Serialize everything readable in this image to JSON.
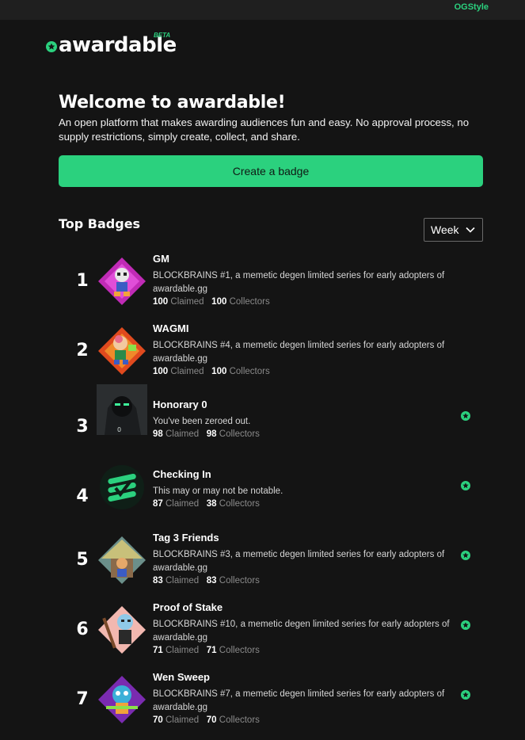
{
  "topbar": {
    "username": "OGStyle"
  },
  "brand": {
    "name": "awardable",
    "beta": "BETA",
    "accent": "#2bd17e"
  },
  "welcome": {
    "title": "Welcome to awardable!",
    "description": "An open platform that makes awarding audiences fun and easy. No approval process, no supply restrictions, simply create, collect, and share.",
    "cta": "Create a badge"
  },
  "top_badges": {
    "title": "Top Badges",
    "period": "Week",
    "claimed_label": "Claimed",
    "collectors_label": "Collectors",
    "items": [
      {
        "rank": "1",
        "name": "GM",
        "description": "BLOCKBRAINS #1, a memetic degen limited series for early adopters of awardable.gg",
        "claimed": "100",
        "collectors": "100",
        "verified": false,
        "art": "skull-pink"
      },
      {
        "rank": "2",
        "name": "WAGMI",
        "description": "BLOCKBRAINS #4, a memetic degen limited series for early adopters of awardable.gg",
        "claimed": "100",
        "collectors": "100",
        "verified": false,
        "art": "brain-orange"
      },
      {
        "rank": "3",
        "name": "Honorary 0",
        "description": "You've been zeroed out.",
        "claimed": "98",
        "collectors": "98",
        "verified": true,
        "art": "hooded-figure"
      },
      {
        "rank": "4",
        "name": "Checking In",
        "description": "This may or may not be notable.",
        "claimed": "87",
        "collectors": "38",
        "verified": true,
        "art": "check-logo"
      },
      {
        "rank": "5",
        "name": "Tag 3 Friends",
        "description": "BLOCKBRAINS #3, a memetic degen limited series for early adopters of awardable.gg",
        "claimed": "83",
        "collectors": "83",
        "verified": true,
        "art": "hut-character"
      },
      {
        "rank": "6",
        "name": "Proof of Stake",
        "description": "BLOCKBRAINS #10, a memetic degen limited series for early adopters of awardable.gg",
        "claimed": "71",
        "collectors": "71",
        "verified": true,
        "art": "stake-character"
      },
      {
        "rank": "7",
        "name": "Wen Sweep",
        "description": "BLOCKBRAINS #7, a memetic degen limited series for early adopters of awardable.gg",
        "claimed": "70",
        "collectors": "70",
        "verified": true,
        "art": "broom-character"
      }
    ]
  }
}
